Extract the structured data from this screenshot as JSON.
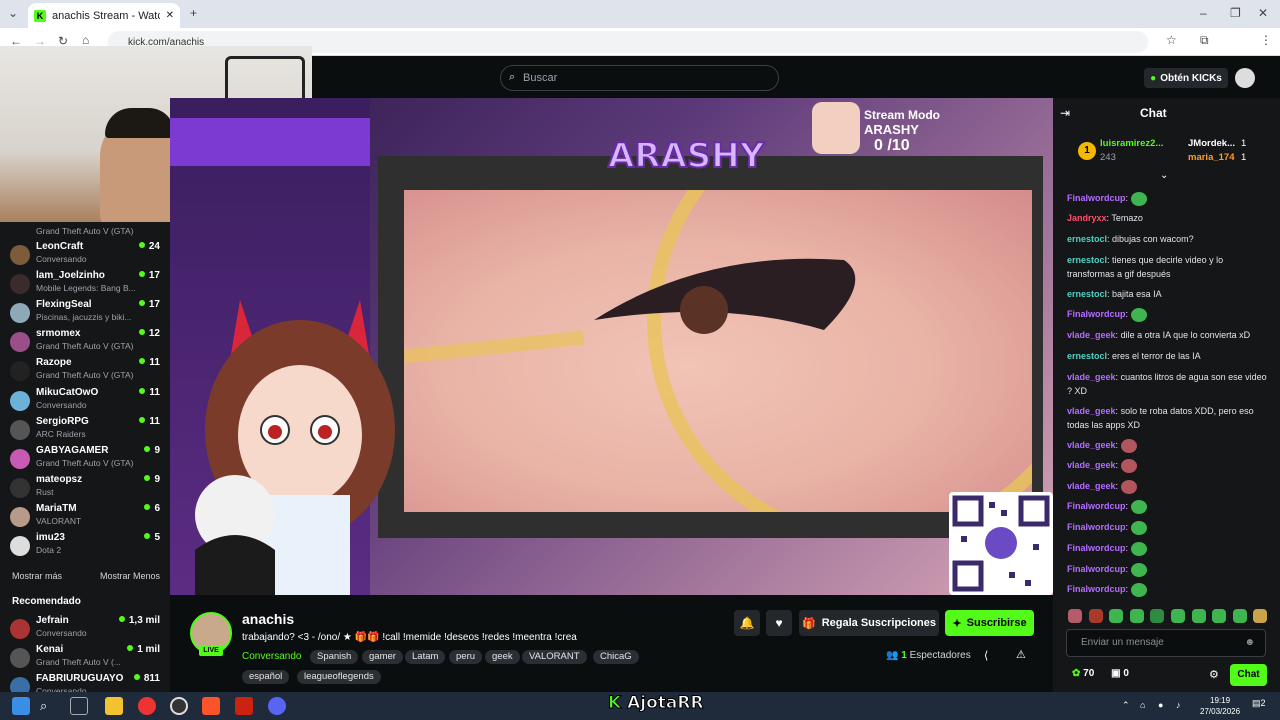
{
  "browser": {
    "tab_title": "anachis Stream - Watch Live on",
    "url": "kick.com/anachis"
  },
  "header": {
    "search_placeholder": "Buscar",
    "kicks_button": "Obtén KICKs"
  },
  "sidebar": {
    "channels": [
      {
        "name": "LeonCraft",
        "category": "Conversando",
        "viewers": "24",
        "color": "#7c5c3b"
      },
      {
        "name": "lam_Joelzinho",
        "category": "Mobile Legends: Bang B...",
        "viewers": "17",
        "color": "#3b2b2b"
      },
      {
        "name": "FlexingSeal",
        "category": "Piscinas, jacuzzis y biki...",
        "viewers": "17",
        "color": "#8fa8b8"
      },
      {
        "name": "srmomex",
        "category": "Grand Theft Auto V (GTA)",
        "viewers": "12",
        "color": "#9b4f8a"
      },
      {
        "name": "Razope",
        "category": "Grand Theft Auto V (GTA)",
        "viewers": "11",
        "color": "#222"
      },
      {
        "name": "MikuCatOwO",
        "category": "Conversando",
        "viewers": "11",
        "color": "#6cb2d8"
      },
      {
        "name": "SergioRPG",
        "category": "ARC Raiders",
        "viewers": "11",
        "color": "#555"
      },
      {
        "name": "GABYAGAMER",
        "category": "Grand Theft Auto V (GTA)",
        "viewers": "9",
        "color": "#c75ab3"
      },
      {
        "name": "mateopsz",
        "category": "Rust",
        "viewers": "9",
        "color": "#333"
      },
      {
        "name": "MariaTM",
        "category": "VALORANT",
        "viewers": "6",
        "color": "#b89a8a"
      },
      {
        "name": "imu23",
        "category": "Dota 2",
        "viewers": "5",
        "color": "#ddd"
      }
    ],
    "top_partial_category": "Grand Theft Auto V (GTA)",
    "show_more": "Mostrar más",
    "show_less": "Mostrar Menos",
    "recommended_title": "Recomendado",
    "recommended": [
      {
        "name": "Jefrain",
        "category": "Conversando",
        "viewers": "1,3 mil",
        "color": "#a33"
      },
      {
        "name": "Kenai",
        "category": "Grand Theft Auto V (...",
        "viewers": "1 mil",
        "color": "#555"
      },
      {
        "name": "FABRIURUGUAYO",
        "category": "Conversando",
        "viewers": "811",
        "color": "#3a6ea5"
      }
    ]
  },
  "overlay": {
    "logo_text": "ARASHY",
    "stream_mode": "Stream Modo",
    "arashy": "ARASHY",
    "counter": "0 /10"
  },
  "stream": {
    "streamer": "anachis",
    "live": "LIVE",
    "title": "trabajando? <3 - /ono/ ★ 🎁🎁 !call !memide !deseos !redes !meentra !crea",
    "category": "Conversando",
    "tags": [
      "Spanish",
      "gamer",
      "Latam",
      "peru",
      "geek",
      "VALORANT",
      "ChicaG",
      "español",
      "leagueoflegends"
    ],
    "gift_button": "Regala Suscripciones",
    "subscribe_button": "Suscribirse",
    "viewers_count": "1",
    "viewers_label": "Espectadores"
  },
  "chat": {
    "title": "Chat",
    "leaderboard": {
      "first_name": "luisramirez2...",
      "first_value": "243",
      "rank": "1",
      "second": [
        {
          "name": "JMordek...",
          "value": "1"
        },
        {
          "name": "maria_174",
          "value": "1"
        }
      ]
    },
    "messages": [
      {
        "user": "Finalwordcup",
        "text": "",
        "color": "#b46cff",
        "emote": true
      },
      {
        "user": "Jandryxx",
        "text": "Temazo",
        "color": "#ff4d6d",
        "emote": false
      },
      {
        "user": "ernestocl",
        "text": "dibujas con wacom?",
        "color": "#4fd1c5",
        "emote": false
      },
      {
        "user": "ernestocl",
        "text": "tienes que decirle video y lo transformas a gif después",
        "color": "#4fd1c5",
        "emote": false
      },
      {
        "user": "ernestocl",
        "text": "bajita esa IA",
        "color": "#4fd1c5",
        "emote": false
      },
      {
        "user": "Finalwordcup",
        "text": "",
        "color": "#b46cff",
        "emote": true
      },
      {
        "user": "vlade_geek",
        "text": "dile a otra IA que lo convierta xD",
        "color": "#b46cff",
        "emote": false
      },
      {
        "user": "ernestocl",
        "text": "eres el terror de las IA",
        "color": "#4fd1c5",
        "emote": false
      },
      {
        "user": "vlade_geek",
        "text": "cuantos litros de agua son ese video ? XD",
        "color": "#b46cff",
        "emote": false
      },
      {
        "user": "vlade_geek",
        "text": "solo te roba datos XDD, pero eso todas las apps XD",
        "color": "#b46cff",
        "emote": false
      },
      {
        "user": "vlade_geek",
        "text": "",
        "color": "#b46cff",
        "emote": true
      },
      {
        "user": "vlade_geek",
        "text": "",
        "color": "#b46cff",
        "emote": true
      },
      {
        "user": "vlade_geek",
        "text": "",
        "color": "#b46cff",
        "emote": true
      },
      {
        "user": "Finalwordcup",
        "text": "",
        "color": "#b46cff",
        "emote": true
      },
      {
        "user": "Finalwordcup",
        "text": "",
        "color": "#b46cff",
        "emote": true
      },
      {
        "user": "Finalwordcup",
        "text": "",
        "color": "#b46cff",
        "emote": true
      },
      {
        "user": "Finalwordcup",
        "text": "",
        "color": "#b46cff",
        "emote": true
      },
      {
        "user": "Finalwordcup",
        "text": "",
        "color": "#b46cff",
        "emote": true
      }
    ],
    "input_placeholder": "Enviar un mensaje",
    "points": "70",
    "drops": "0",
    "chat_button": "Chat"
  },
  "taskbar": {
    "time": "19:19",
    "date": "27/03/2026",
    "watermark": "AjotaRR",
    "notif_count": "2"
  },
  "colors": {
    "kick_green": "#53fc18",
    "background": "#0b0e0f",
    "panel": "#141618"
  }
}
